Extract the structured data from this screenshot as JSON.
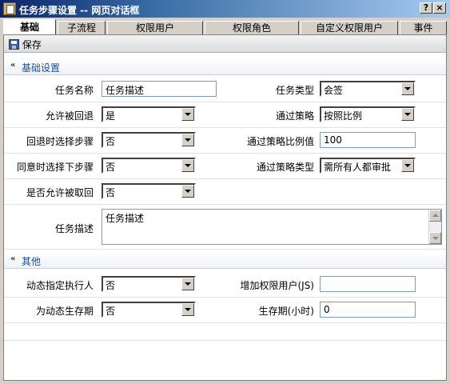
{
  "window": {
    "title": "任务步骤设置 -- 网页对话框",
    "help_label": "?",
    "close_label": "×"
  },
  "tabs": [
    {
      "label": "基础",
      "active": true
    },
    {
      "label": "子流程",
      "active": false
    },
    {
      "label": "权限用户",
      "active": false
    },
    {
      "label": "权限角色",
      "active": false
    },
    {
      "label": "自定义权限用户",
      "active": false
    },
    {
      "label": "事件",
      "active": false
    }
  ],
  "toolbar": {
    "save_label": "保存"
  },
  "sections": {
    "basic": "基础设置",
    "other": "其他"
  },
  "form": {
    "task_name": {
      "label": "任务名称",
      "value": "任务描述"
    },
    "task_type": {
      "label": "任务类型",
      "value": "会签"
    },
    "allow_rollback": {
      "label": "允许被回退",
      "value": "是"
    },
    "pass_strategy": {
      "label": "通过策略",
      "value": "按照比例"
    },
    "rollback_choose_step": {
      "label": "回退时选择步骤",
      "value": "否"
    },
    "pass_ratio": {
      "label": "通过策略比例值",
      "value": "100"
    },
    "agree_choose_next": {
      "label": "同意时选择下步骤",
      "value": "否"
    },
    "pass_strategy_type": {
      "label": "通过策略类型",
      "value": "需所有人都审批"
    },
    "allow_retrieve": {
      "label": "是否允许被取回",
      "value": "否"
    },
    "task_desc": {
      "label": "任务描述",
      "value": "任务描述"
    }
  },
  "other": {
    "dynamic_executor": {
      "label": "动态指定执行人",
      "value": "否"
    },
    "add_perm_user": {
      "label": "增加权限用户(JS)",
      "value": ""
    },
    "dynamic_lifetime": {
      "label": "为动态生存期",
      "value": "否"
    },
    "lifetime_hours": {
      "label": "生存期(小时)",
      "value": "0"
    }
  }
}
